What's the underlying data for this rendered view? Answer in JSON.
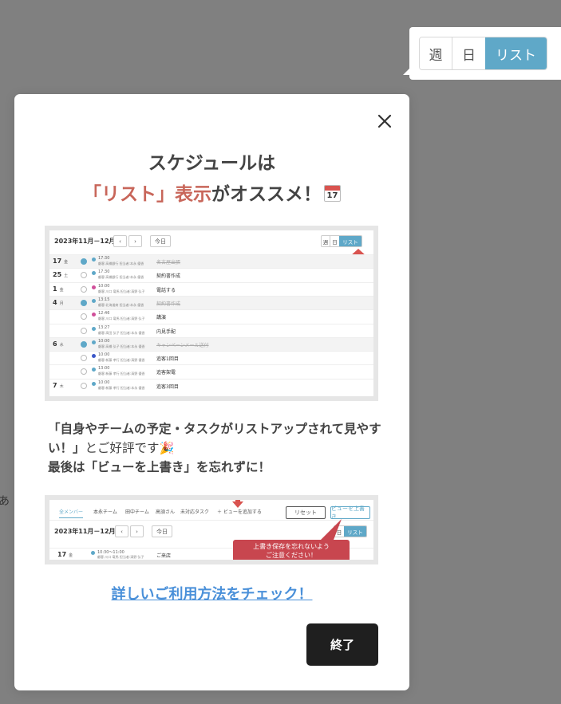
{
  "background_peek_text": "あ",
  "view_switcher": {
    "week": "週",
    "day": "日",
    "list": "リスト"
  },
  "modal": {
    "title_line1": "スケジュールは",
    "title_highlight": "「リスト」表示",
    "title_rest": "がオススメ！",
    "calendar_emoji_number": "17",
    "body_line1": "「自身やチームの予定・タスクがリストアップされて見やすい！」",
    "body_line1_suffix": "とご好評です",
    "body_line2": "最後は「ビューを上書き」を忘れずに！",
    "link_text": "詳しいご利用方法をチェック！",
    "done_label": "終了"
  },
  "screenshot1": {
    "range": "2023年11月－12月",
    "today": "今日",
    "seg": {
      "week": "週",
      "day": "日",
      "list": "リスト"
    },
    "rows": [
      {
        "date": "17",
        "wd": "金",
        "time": "17:30",
        "sub": "顧客:高橋銀行 担当者:本永 優香",
        "title": "名古屋出張",
        "done": true,
        "dot": "#5fa8c8",
        "grey": true,
        "strike": true
      },
      {
        "date": "25",
        "wd": "土",
        "time": "17:30",
        "sub": "顧客:高橋銀行 担当者:本永 優香",
        "title": "契約書作成",
        "done": false,
        "dot": "#5fa8c8",
        "grey": false,
        "strike": false
      },
      {
        "date": "1",
        "wd": "金",
        "time": "10:00",
        "sub": "顧客:川口 竜馬 担当者:清野 弘子",
        "title": "電話する",
        "done": false,
        "dot": "#d04f9a",
        "grey": false,
        "strike": false
      },
      {
        "date": "4",
        "wd": "月",
        "time": "13:15",
        "sub": "顧客:北海道商 担当者:本永 優香",
        "title": "契約書作成",
        "done": true,
        "dot": "#5fa8c8",
        "grey": true,
        "strike": true
      },
      {
        "date": "",
        "wd": "",
        "time": "12:46",
        "sub": "顧客:川口 竜馬 担当者:清野 弘子",
        "title": "講演",
        "done": false,
        "dot": "#d04f9a",
        "grey": false,
        "strike": false
      },
      {
        "date": "",
        "wd": "",
        "time": "13:27",
        "sub": "顧客:高田 弘子 担当者:本永 優香",
        "title": "内見手配",
        "done": false,
        "dot": "#5fa8c8",
        "grey": false,
        "strike": false
      },
      {
        "date": "6",
        "wd": "水",
        "time": "10:00",
        "sub": "顧客:高橋 弘子 担当者:本永 優香",
        "title": "キャンペーンメール送付",
        "done": true,
        "dot": "#5fa8c8",
        "grey": true,
        "strike": true
      },
      {
        "date": "",
        "wd": "",
        "time": "10:00",
        "sub": "顧客:新藤 孝行 担当者:清野 優香",
        "title": "追客1回目",
        "done": false,
        "dot": "#3b57c8",
        "grey": false,
        "strike": false
      },
      {
        "date": "",
        "wd": "",
        "time": "13:00",
        "sub": "顧客:新藤 孝行 担当者:清野 優香",
        "title": "追客架電",
        "done": false,
        "dot": "#5fa8c8",
        "grey": false,
        "strike": false
      },
      {
        "date": "7",
        "wd": "木",
        "time": "10:00",
        "sub": "顧客:新藤 孝行 担当者:本永 優香",
        "title": "追客3回目",
        "done": false,
        "dot": "#5fa8c8",
        "grey": false,
        "strike": false
      }
    ]
  },
  "screenshot2": {
    "tabs": [
      "全メンバー",
      "本永チーム",
      "田中チーム",
      "高須さん",
      "未対応タスク",
      "＋ ビューを追加する"
    ],
    "reset": "リセット",
    "overwrite": "ビューを上書き",
    "range": "2023年11月－12月",
    "today": "今日",
    "day": "日",
    "list": "リスト",
    "row_date": "17",
    "row_wd": "金",
    "row_time": "10:30〜11:00",
    "row_sub": "顧客:川口 竜馬 担当者:清野 弘子",
    "row_title": "ご来店",
    "callout_line1": "上書き保存を忘れないよう",
    "callout_line2": "ご注意ください！"
  },
  "colors": {
    "accent": "#5fa8c8",
    "highlight": "#c8665a",
    "link": "#4a90d9",
    "button": "#1f1f1f",
    "callout": "#c8464f"
  }
}
